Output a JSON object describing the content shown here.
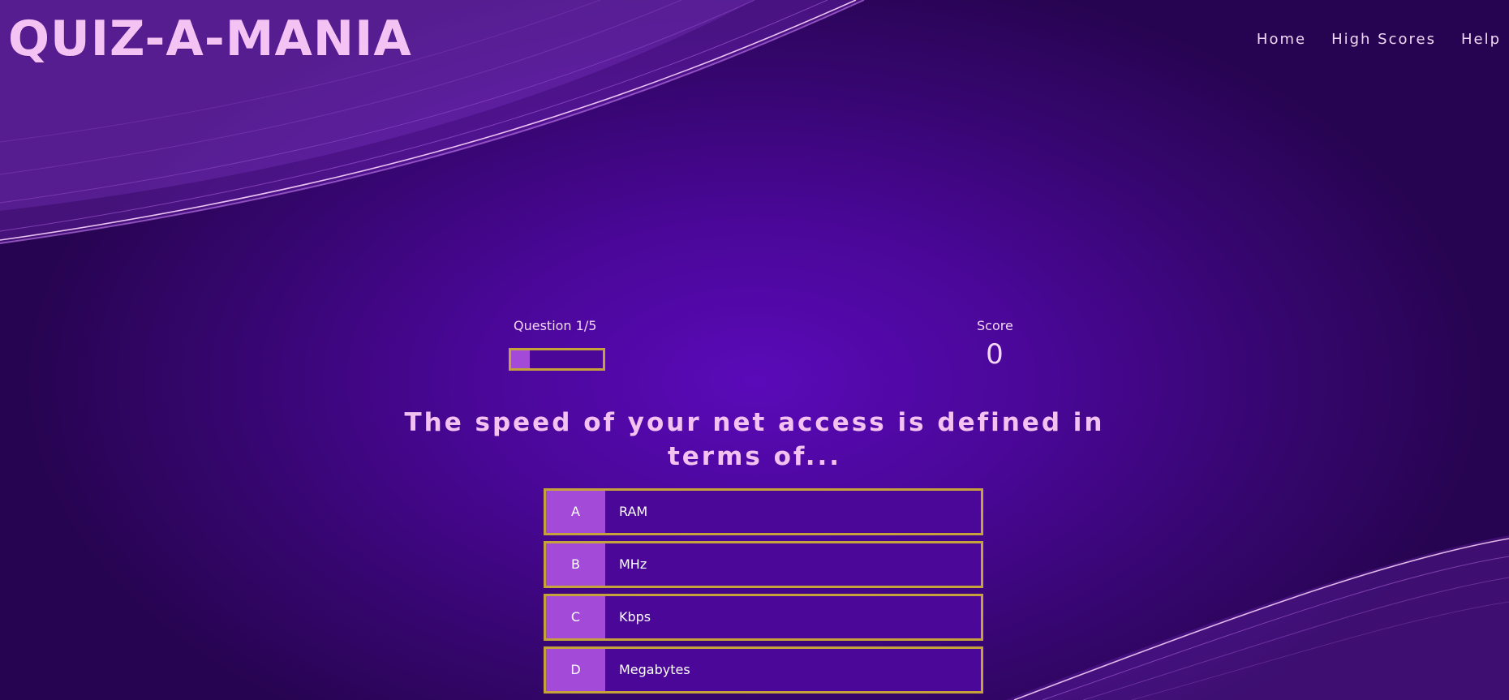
{
  "header": {
    "logo": "QUIZ-A-MANIA",
    "nav": [
      {
        "label": "Home"
      },
      {
        "label": "High Scores"
      },
      {
        "label": "Help"
      }
    ]
  },
  "hud": {
    "question_label": "Question 1/5",
    "progress_fraction": 0.2,
    "score_label": "Score",
    "score_value": "0"
  },
  "question": {
    "text": "The speed of your net access is defined in terms of..."
  },
  "choices": [
    {
      "prefix": "A",
      "text": "RAM"
    },
    {
      "prefix": "B",
      "text": "MHz"
    },
    {
      "prefix": "C",
      "text": "Kbps"
    },
    {
      "prefix": "D",
      "text": "Megabytes"
    }
  ],
  "colors": {
    "background": "#4a0798",
    "accent": "#a34bd8",
    "border": "#c6a33a",
    "title_text": "#f4c3f4"
  }
}
